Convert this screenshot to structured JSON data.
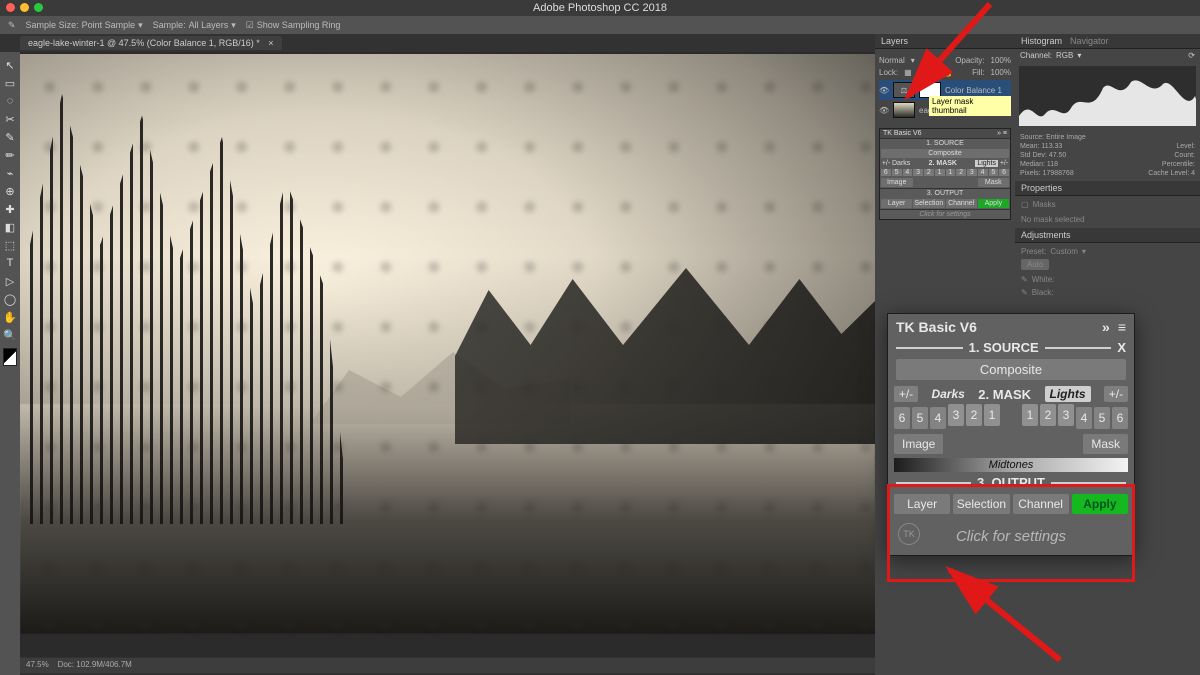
{
  "app": {
    "title": "Adobe Photoshop CC 2018"
  },
  "topbar": {
    "sample_size_label": "Sample Size:",
    "sample_size_value": "Point Sample",
    "sample_label": "Sample:",
    "sample_value": "All Layers",
    "show_ring": "Show Sampling Ring"
  },
  "tab": {
    "name": "eagle-lake-winter-1 @ 47.5% (Color Balance 1, RGB/16) *"
  },
  "tools": [
    "↖",
    "▭",
    "◌",
    "✂",
    "✎",
    "✏",
    "⌁",
    "⊕",
    "✚",
    "◧",
    "⬚",
    "T",
    "▷",
    "◯",
    "✋",
    "🔍"
  ],
  "status": {
    "zoom": "47.5%",
    "doc": "Doc: 102.9M/406.7M"
  },
  "layers": {
    "title": "Layers",
    "blend": "Normal",
    "opacity_label": "Opacity:",
    "opacity": "100%",
    "lock_label": "Lock:",
    "fill_label": "Fill:",
    "fill": "100%",
    "layer1_name": "Color Balance 1",
    "tooltip": "Layer mask thumbnail",
    "layer2_name": "eagle-lake-winter"
  },
  "histogram": {
    "tab1": "Histogram",
    "tab2": "Navigator",
    "channel_label": "Channel:",
    "channel": "RGB",
    "src_label": "Source:",
    "src": "Entire Image",
    "mean_label": "Mean:",
    "mean": "113.33",
    "level_label": "Level:",
    "sd_label": "Std Dev:",
    "sd": "47.50",
    "count_label": "Count:",
    "median_label": "Median:",
    "median": "118",
    "pct_label": "Percentile:",
    "pixels_label": "Pixels:",
    "pixels": "17988768",
    "cache_label": "Cache Level:",
    "cache": "4"
  },
  "props": {
    "title": "Properties",
    "sub": "Masks",
    "msg": "No mask selected"
  },
  "adjust": {
    "title": "Adjustments",
    "preset": "Preset:",
    "custom": "Custom",
    "auto": "Auto",
    "white_label": "White:",
    "black_label": "Black:"
  },
  "mini_tk": {
    "title": "TK Basic V6",
    "sec1": "1. SOURCE",
    "composite": "Composite",
    "darks": "Darks",
    "sec2": "2. MASK",
    "lights": "Lights",
    "nums": [
      "6",
      "5",
      "4",
      "3",
      "2",
      "1",
      "1",
      "2",
      "3",
      "4",
      "5",
      "6"
    ],
    "image": "Image",
    "mask": "Mask",
    "sec3": "3. OUTPUT",
    "layer": "Layer",
    "sel": "Selection",
    "chan": "Channel",
    "apply": "Apply",
    "settings": "Click for settings"
  },
  "tk": {
    "title": "TK Basic V6",
    "sec1": "1. SOURCE",
    "composite": "Composite",
    "darks": "Darks",
    "sec2": "2. MASK",
    "lights": "Lights",
    "nums_left": [
      "6",
      "5",
      "4",
      "3",
      "2",
      "1"
    ],
    "nums_right": [
      "1",
      "2",
      "3",
      "4",
      "5",
      "6"
    ],
    "image": "Image",
    "mask": "Mask",
    "midtones": "Midtones",
    "sec3": "3. OUTPUT",
    "out_layer": "Layer",
    "out_sel": "Selection",
    "out_chan": "Channel",
    "apply": "Apply",
    "settings": "Click for settings",
    "chev": "»",
    "x": "X",
    "pm": "+/-"
  }
}
